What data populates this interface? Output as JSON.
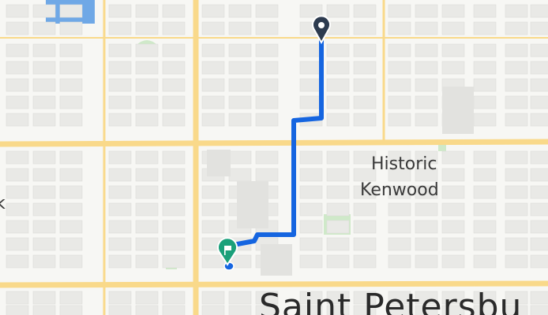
{
  "map": {
    "labels": {
      "neighborhood_line1": "Historic",
      "neighborhood_line2": "Kenwood",
      "city": "Saint Petersbu",
      "edge_fragment": "k"
    },
    "route": {
      "color": "#1565e0",
      "start_marker_color": "#2d3b4f",
      "end_marker_color": "#1aa07a",
      "end_marker_icon": "flag-icon"
    },
    "colors": {
      "background": "#f7f7f4",
      "major_road": "#f9d98a",
      "block": "#e9e9e6",
      "water": "#6fa8e6",
      "park": "#cfe9c9"
    }
  }
}
